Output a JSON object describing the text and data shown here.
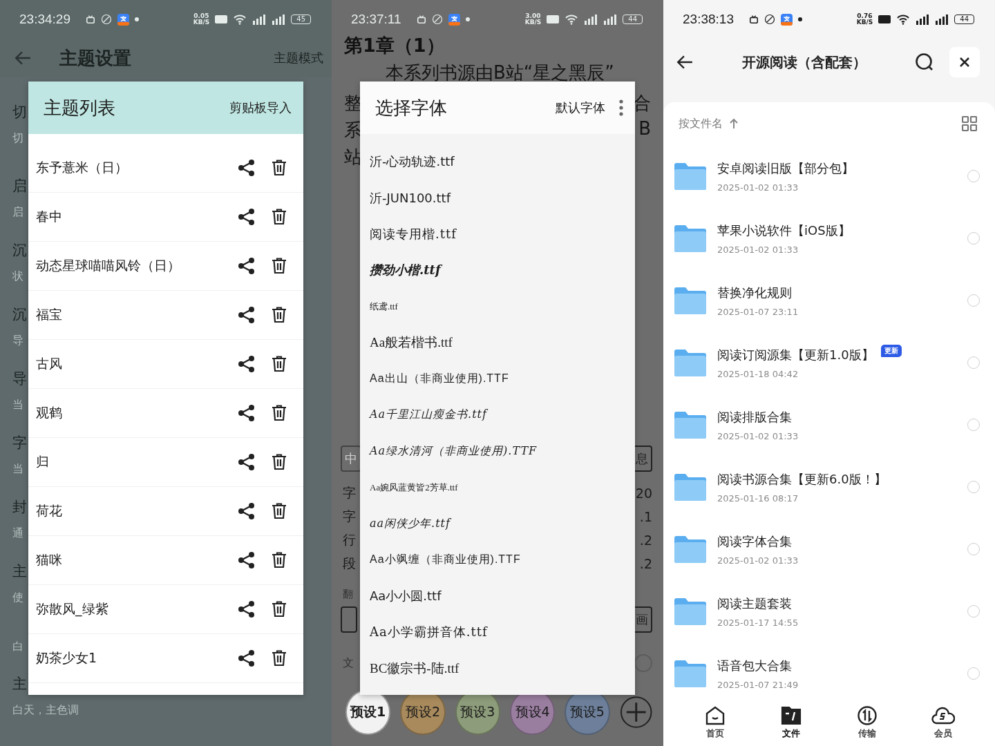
{
  "theme_screen": {
    "status_bar": {
      "time": "23:34:29",
      "speed": "0.05",
      "speed_unit": "KB/S",
      "battery": "45"
    },
    "title": "主题设置",
    "action": "主题模式",
    "background_rows": [
      {
        "title": "切",
        "subtitle": "切"
      },
      {
        "title": "启",
        "subtitle": "启"
      },
      {
        "title": "沉",
        "subtitle": "状"
      },
      {
        "title": "沉",
        "subtitle": "导"
      },
      {
        "title": "导",
        "subtitle": "当"
      },
      {
        "title": "字",
        "subtitle": "当"
      },
      {
        "title": "封",
        "subtitle": "通"
      },
      {
        "title": "主",
        "subtitle": "使"
      },
      {
        "subtitle": "白"
      },
      {
        "title": "主",
        "subtitle": "白天，主色调"
      }
    ],
    "dialog": {
      "title": "主题列表",
      "action": "剪贴板导入",
      "themes": [
        "东予薏米（日）",
        "春中",
        "动态星球喵喵风铃（日）",
        "福宝",
        "古风",
        "观鹤",
        "归",
        "荷花",
        "猫咪",
        "弥散风_绿紫",
        "奶茶少女1"
      ]
    }
  },
  "font_screen": {
    "status_bar": {
      "time": "23:37:11",
      "speed": "3.00",
      "speed_unit": "KB/S",
      "battery": "44"
    },
    "chapter_title": "第1章（1）",
    "first_line": "本系列书源由B站“星之黑辰”",
    "left_chars": [
      "整",
      "系",
      "站"
    ],
    "right_chars": [
      "合",
      "B"
    ],
    "dialog": {
      "title": "选择字体",
      "action": "默认字体",
      "fonts": [
        {
          "name": "沂-心动轨迹.ttf",
          "kind": "plain"
        },
        {
          "name": "沂-JUN100.ttf",
          "kind": "plain"
        },
        {
          "name": "阅读专用楷.ttf",
          "kind": "kai"
        },
        {
          "name": "攒劲小楷.ttf",
          "kind": "brush"
        },
        {
          "name": "纸鸢.ttf",
          "kind": "tiny"
        },
        {
          "name": "Aa般若楷书.ttf",
          "kind": "serif"
        },
        {
          "name": "Aa出山（非商业使用).TTF",
          "kind": "thin"
        },
        {
          "name": "Aa千里江山瘦金书.ttf",
          "kind": "hand"
        },
        {
          "name": "Aa绿水清河（非商业使用).TTF",
          "kind": "hand"
        },
        {
          "name": "Aa婉风蓝黄皆2芳草.ttf",
          "kind": "tiny"
        },
        {
          "name": "aa闲侠少年.ttf",
          "kind": "hand"
        },
        {
          "name": "Aa小飒缠（非商业使用).TTF",
          "kind": "thin"
        },
        {
          "name": "Aa小小圆.ttf",
          "kind": "plain"
        },
        {
          "name": "Aa小学霸拼音体.ttf",
          "kind": "kai"
        },
        {
          "name": "BC徽宗书-陆.ttf",
          "kind": "serif"
        }
      ]
    },
    "top_buttons": [
      "中",
      "息"
    ],
    "settings": [
      {
        "label": "字",
        "value": "20"
      },
      {
        "label": "字",
        "value": ".1"
      },
      {
        "label": "行",
        "value": ".2"
      },
      {
        "label": "段",
        "value": ".2"
      }
    ],
    "page_turn_label": "翻",
    "mode_button": "画",
    "text_label": "文",
    "text_toggle": {
      "on": false
    },
    "presets": [
      {
        "label": "预设1",
        "color": "#f2f2f2",
        "selected": true
      },
      {
        "label": "预设2",
        "color": "#a88a5c",
        "selected": false
      },
      {
        "label": "预设3",
        "color": "#8d9c7a",
        "selected": false
      },
      {
        "label": "预设4",
        "color": "#9a7ea0",
        "selected": false
      },
      {
        "label": "预设5",
        "color": "#6d7f9a",
        "selected": false
      }
    ]
  },
  "files_screen": {
    "status_bar": {
      "time": "23:38:13",
      "speed": "0.76",
      "speed_unit": "KB/S",
      "battery": "44"
    },
    "title": "开源阅读（含配套）",
    "sort_label": "按文件名",
    "files": [
      {
        "name": "安卓阅读旧版【部分包】",
        "date": "2025-01-02 01:33",
        "selected": false
      },
      {
        "name": "苹果小说软件【iOS版】",
        "date": "2025-01-02 01:33",
        "selected": false
      },
      {
        "name": "替换净化规则",
        "date": "2025-01-07 23:11",
        "selected": false
      },
      {
        "name": "阅读订阅源集【更新1.0版】",
        "date": "2025-01-18 04:42",
        "badge": "更新",
        "selected": false
      },
      {
        "name": "阅读排版合集",
        "date": "2025-01-02 01:33",
        "selected": false
      },
      {
        "name": "阅读书源合集【更新6.0版！】",
        "date": "2025-01-16 08:17",
        "selected": false
      },
      {
        "name": "阅读字体合集",
        "date": "2025-01-02 01:33",
        "selected": false
      },
      {
        "name": "阅读主题套装",
        "date": "2025-01-17 14:55",
        "selected": false
      },
      {
        "name": "语音包大合集",
        "date": "2025-01-07 21:49",
        "selected": false
      }
    ],
    "nav": [
      {
        "label": "首页",
        "kind": "home",
        "selected": false
      },
      {
        "label": "文件",
        "kind": "files",
        "selected": true
      },
      {
        "label": "传输",
        "kind": "transfer",
        "selected": false
      },
      {
        "label": "会员",
        "kind": "member",
        "selected": false
      }
    ]
  }
}
